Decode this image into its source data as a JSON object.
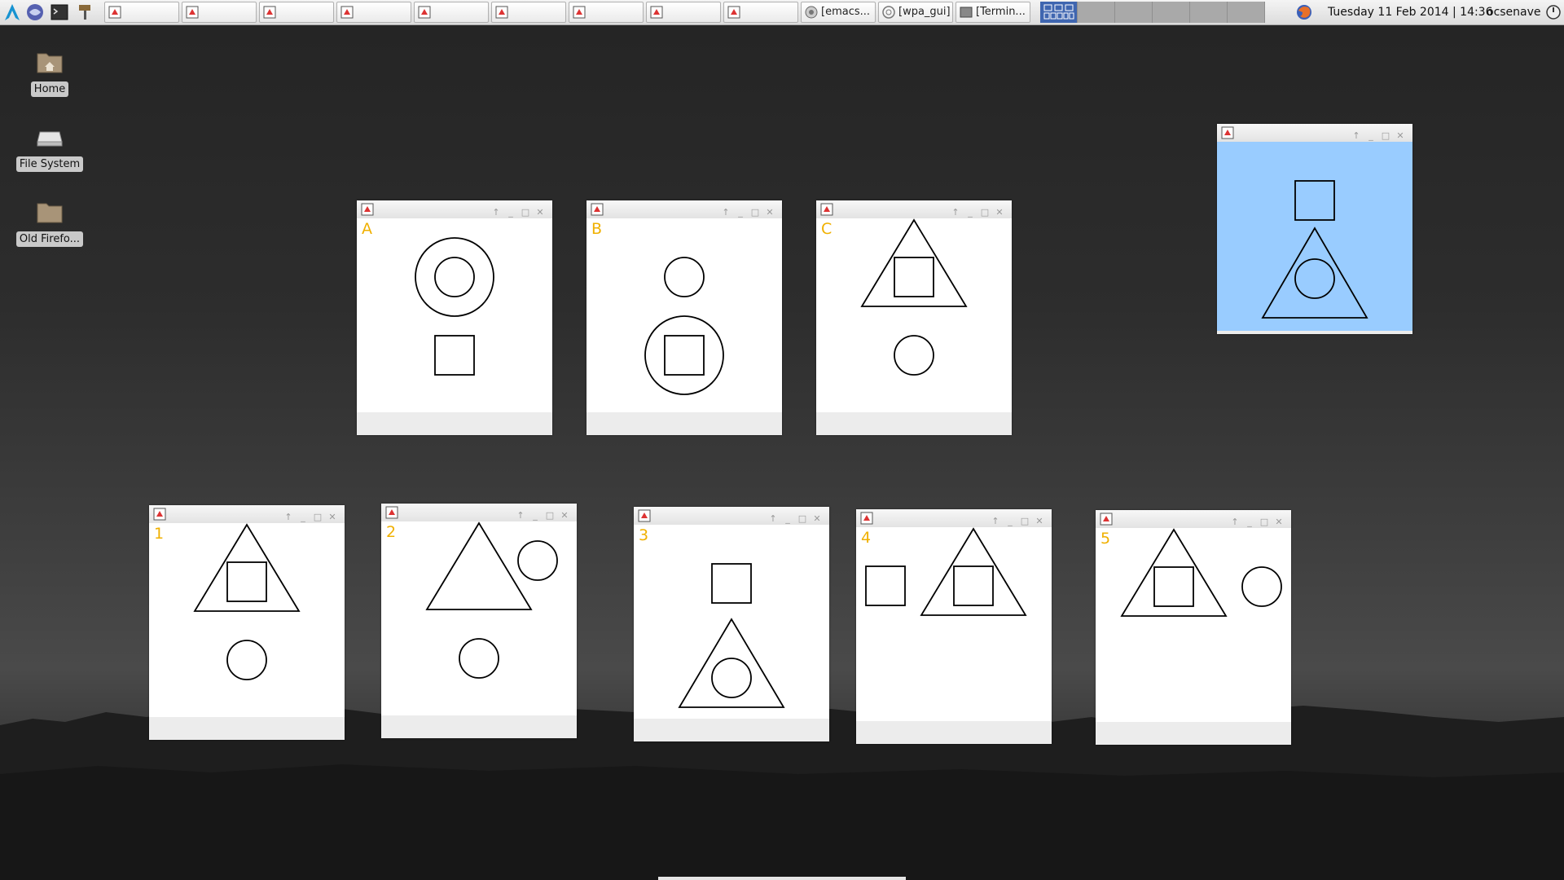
{
  "panel": {
    "taskbar_items": [
      {
        "label": "",
        "icon": "java-app-icon"
      },
      {
        "label": "",
        "icon": "java-app-icon"
      },
      {
        "label": "",
        "icon": "java-app-icon"
      },
      {
        "label": "",
        "icon": "java-app-icon"
      },
      {
        "label": "",
        "icon": "java-app-icon"
      },
      {
        "label": "",
        "icon": "java-app-icon"
      },
      {
        "label": "",
        "icon": "java-app-icon"
      },
      {
        "label": "",
        "icon": "java-app-icon"
      },
      {
        "label": "",
        "icon": "java-app-icon"
      },
      {
        "label": "[emacs...",
        "icon": "emacs-icon"
      },
      {
        "label": "[wpa_gui]",
        "icon": "wpa-gui-icon"
      },
      {
        "label": "[Termin...",
        "icon": "terminal-icon"
      }
    ],
    "clock": "Tuesday 11 Feb 2014 | 14:36",
    "user": "ocsenave"
  },
  "desktop_icons": [
    {
      "label": "Home",
      "icon": "home-folder-icon"
    },
    {
      "label": "File System",
      "icon": "drive-icon"
    },
    {
      "label": "Old Firefo...",
      "icon": "folder-icon"
    }
  ],
  "puzzle_windows": {
    "wA": {
      "label": "A"
    },
    "wB": {
      "label": "B"
    },
    "wC": {
      "label": "C"
    },
    "w1": {
      "label": "1"
    },
    "w2": {
      "label": "2"
    },
    "w3": {
      "label": "3"
    },
    "w4": {
      "label": "4"
    },
    "w5": {
      "label": "5"
    },
    "wQ": {
      "label": ""
    }
  },
  "colors": {
    "panel": "#e8e8e8",
    "label_yellow": "#f0b000",
    "query_window_bg": "#99ccff",
    "pager_active": "#3f66b0"
  }
}
